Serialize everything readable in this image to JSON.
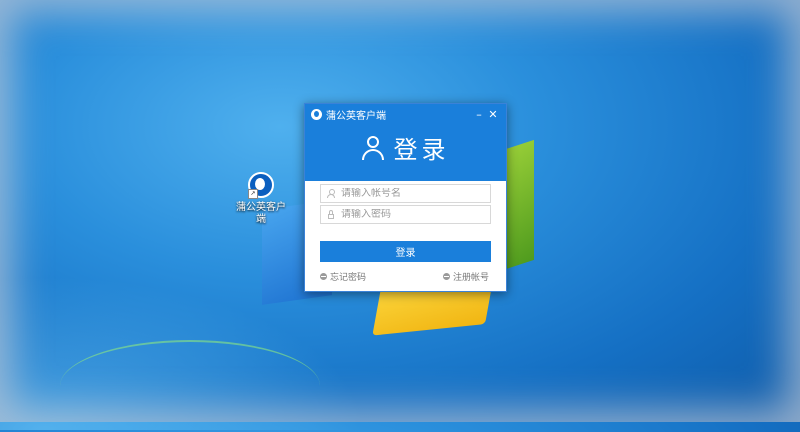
{
  "desktop": {
    "icon_label": "蒲公英客户端"
  },
  "dialog": {
    "title": "蒲公英客户端",
    "minimize_symbol": "–",
    "close_symbol": "✕",
    "heading": "登录",
    "account_placeholder": "请输入帐号名",
    "password_placeholder": "请输入密码",
    "login_button": "登录",
    "forgot_password": "忘记密码",
    "register_account": "注册帐号",
    "accent_color": "#1a7fdb"
  }
}
